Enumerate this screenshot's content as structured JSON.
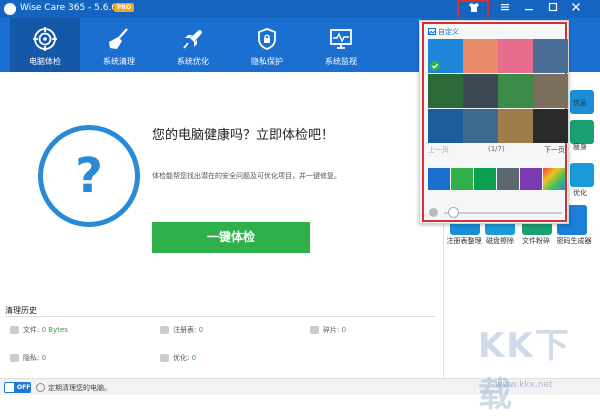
{
  "app": {
    "title": "Wise Care 365 - 5.6.6",
    "badge": "PRO"
  },
  "toolbar": {
    "items": [
      {
        "label": "电脑体检",
        "icon": "target-icon"
      },
      {
        "label": "系统清理",
        "icon": "broom-icon"
      },
      {
        "label": "系统优化",
        "icon": "rocket-icon"
      },
      {
        "label": "隐私保护",
        "icon": "shield-icon"
      },
      {
        "label": "系统监视",
        "icon": "monitor-icon"
      }
    ]
  },
  "main": {
    "question_mark": "?",
    "headline": "您的电脑健康吗？立即体检吧！",
    "description": "体检能帮您找出潜在的安全问题及可优化项目，并一键修复。",
    "check_button": "一键体检"
  },
  "history": {
    "title": "清理历史",
    "items": [
      {
        "label": "文件:",
        "value": "0 Bytes"
      },
      {
        "label": "注册表:",
        "value": "0"
      },
      {
        "label": "碎片:",
        "value": "0"
      },
      {
        "label": "隐私:",
        "value": "0"
      },
      {
        "label": "优化:",
        "value": "0"
      }
    ]
  },
  "footer": {
    "toggle": "OFF",
    "text": "定期清理您的电脑。"
  },
  "sidebar": {
    "partial_labels": [
      "信息",
      "瘦身",
      "优化"
    ],
    "tools": [
      {
        "label": "注册表整理"
      },
      {
        "label": "磁盘擦除"
      },
      {
        "label": "文件粉碎"
      },
      {
        "label": "密码生成器"
      }
    ]
  },
  "skin_popup": {
    "custom": "自定义",
    "prev": "上一页",
    "page": "(1/7)",
    "next": "下一页",
    "thumbnails": [
      "#1e86d8",
      "#e88a6a",
      "#e86c8e",
      "#4a6e95",
      "#2d6a3a",
      "#3b4a52",
      "#3c8a48",
      "#7b6e5a",
      "#1c5c9c",
      "#3a6a8e",
      "#a07c4a",
      "#2a2a2a"
    ],
    "colors": [
      "#1a6fd1",
      "#2fb04a",
      "#0aa050",
      "#5a6770",
      "#7a3bb0",
      "#e84040"
    ]
  },
  "watermark": {
    "text": "KK下载",
    "url": "www.kkx.net"
  }
}
